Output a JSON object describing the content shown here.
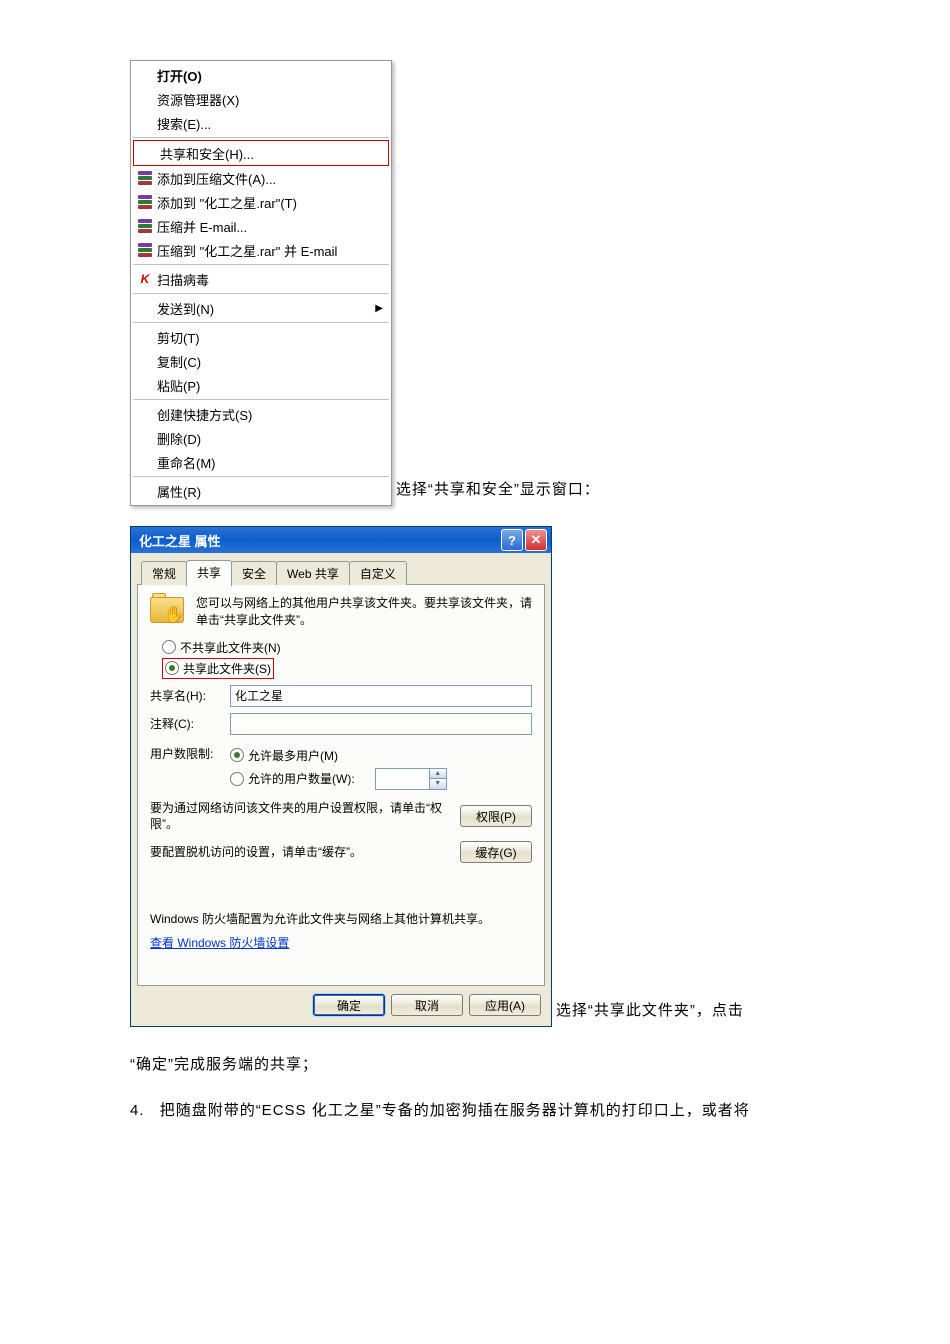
{
  "context_menu": {
    "items": {
      "open": "打开(O)",
      "explorer": "资源管理器(X)",
      "search": "搜索(E)...",
      "share_security": "共享和安全(H)...",
      "add_archive": "添加到压缩文件(A)...",
      "add_to_rar": "添加到 \"化工之星.rar\"(T)",
      "compress_email": "压缩并 E-mail...",
      "compress_rar_email": "压缩到 \"化工之星.rar\" 并 E-mail",
      "scan_virus": "扫描病毒",
      "send_to": "发送到(N)",
      "cut": "剪切(T)",
      "copy": "复制(C)",
      "paste": "粘贴(P)",
      "create_shortcut": "创建快捷方式(S)",
      "delete": "删除(D)",
      "rename": "重命名(M)",
      "properties": "属性(R)"
    }
  },
  "caption1": "选择“共享和安全”显示窗口：",
  "dialog": {
    "title": "化工之星 属性",
    "tabs": {
      "general": "常规",
      "share": "共享",
      "security": "安全",
      "web_share": "Web 共享",
      "custom": "自定义"
    },
    "intro": "您可以与网络上的其他用户共享该文件夹。要共享该文件夹，请单击“共享此文件夹”。",
    "radio": {
      "no_share": "不共享此文件夹(N)",
      "share": "共享此文件夹(S)"
    },
    "fields": {
      "share_name_label": "共享名(H):",
      "share_name_value": "化工之星",
      "comment_label": "注释(C):",
      "comment_value": "",
      "limit_label": "用户数限制:",
      "max_users": "允许最多用户(M)",
      "allow_count": "允许的用户数量(W):"
    },
    "perm_text": "要为通过网络访问该文件夹的用户设置权限，请单击“权限”。",
    "perm_button": "权限(P)",
    "cache_text": "要配置脱机访问的设置，请单击“缓存”。",
    "cache_button": "缓存(G)",
    "firewall_text": "Windows 防火墙配置为允许此文件夹与网络上其他计算机共享。",
    "firewall_link": "查看 Windows 防火墙设置",
    "buttons": {
      "ok": "确定",
      "cancel": "取消",
      "apply": "应用(A)"
    }
  },
  "caption2": "选择“共享此文件夹”，点击",
  "caption3": "“确定”完成服务端的共享；",
  "step4": {
    "num": "4.",
    "text": "把随盘附带的“ECSS 化工之星”专备的加密狗插在服务器计算机的打印口上，或者将"
  }
}
